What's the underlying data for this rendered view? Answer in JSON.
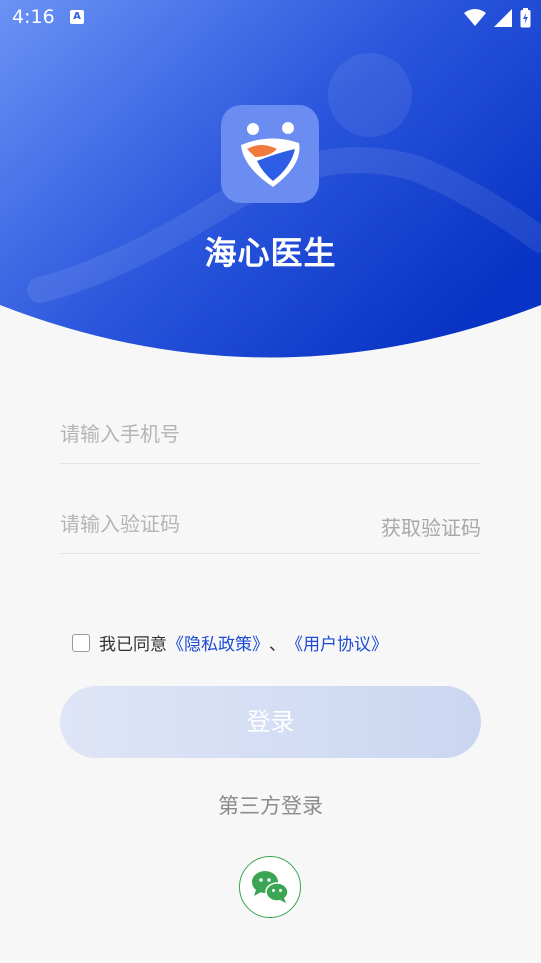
{
  "status_bar": {
    "time": "4:16",
    "notice_icon_letter": "A"
  },
  "app": {
    "name": "海心医生"
  },
  "form": {
    "phone_placeholder": "请输入手机号",
    "code_placeholder": "请输入验证码",
    "get_code_label": "获取验证码"
  },
  "agreement": {
    "prefix": "我已同意",
    "privacy_link": "《隐私政策》",
    "separator": "、",
    "user_link": "《用户协议》"
  },
  "login_button": "登录",
  "third_party_label": "第三方登录",
  "colors": {
    "header_start": "#5a86f2",
    "header_end": "#0a36c8",
    "link": "#1e4bd2",
    "wechat": "#3aa552"
  },
  "icons": {
    "wechat": "wechat-icon",
    "logo": "heart-logo-icon"
  }
}
